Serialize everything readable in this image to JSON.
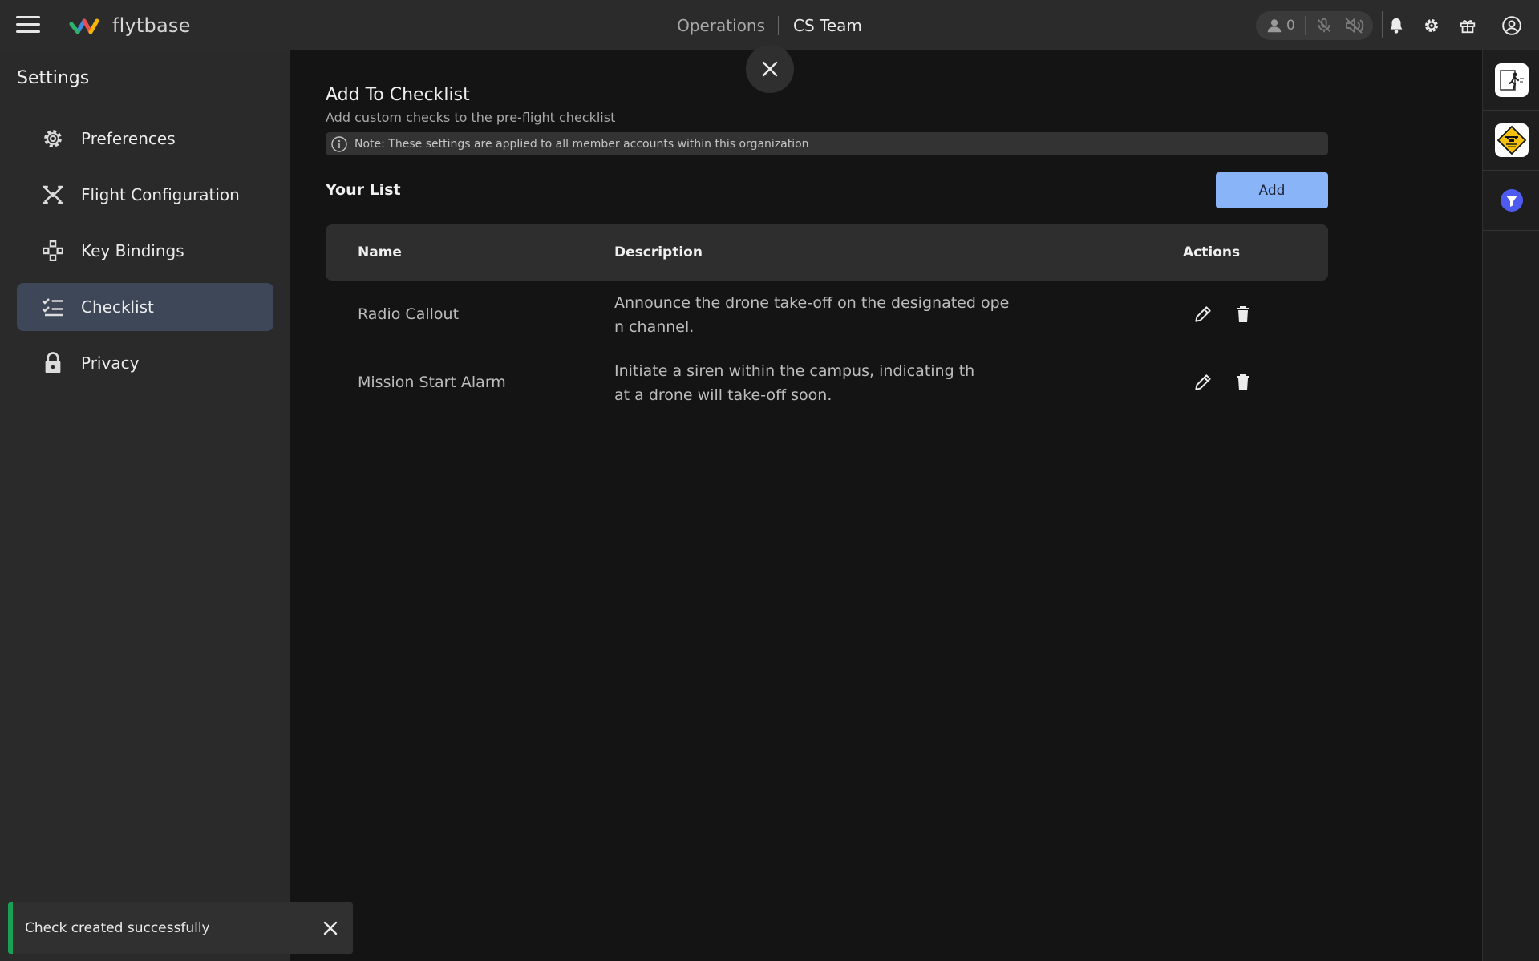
{
  "app": {
    "brand": "flytbase",
    "nav": {
      "operations": "Operations",
      "team": "CS Team"
    },
    "participants_count": "0"
  },
  "icons": {
    "menu": "hamburger-icon",
    "user": "user-icon",
    "mic": "mic-off-icon",
    "speaker": "speaker-off-icon",
    "bell": "bell-icon",
    "gear": "gear-icon",
    "gift": "gift-icon",
    "account": "account-icon",
    "close": "close-icon",
    "info": "info-icon",
    "edit": "pencil-icon",
    "delete": "trash-icon"
  },
  "sidebar": {
    "title": "Settings",
    "items": [
      {
        "label": "Preferences",
        "icon": "gear-icon",
        "active": false
      },
      {
        "label": "Flight Configuration",
        "icon": "drone-icon",
        "active": false
      },
      {
        "label": "Key Bindings",
        "icon": "gamepad-icon",
        "active": false
      },
      {
        "label": "Checklist",
        "icon": "checklist-icon",
        "active": true
      },
      {
        "label": "Privacy",
        "icon": "lock-icon",
        "active": false
      }
    ]
  },
  "main": {
    "title": "Add To Checklist",
    "subtitle": "Add custom checks to the pre-flight checklist",
    "note": "Note: These settings are applied to all member accounts within this organization",
    "list_title": "Your List",
    "add_label": "Add",
    "table": {
      "columns": [
        "Name",
        "Description",
        "Actions"
      ],
      "rows": [
        {
          "name": "Radio Callout",
          "description": "Announce the drone take-off on the designated open channel."
        },
        {
          "name": "Mission Start Alarm",
          "description": "Initiate a siren within the campus, indicating that a drone will take-off soon."
        }
      ]
    }
  },
  "toast": {
    "message": "Check created successfully"
  },
  "colors": {
    "accent": "#8ab4f8",
    "active_item": "#3d4758",
    "success": "#1aa052",
    "topbar": "#2b2b2b",
    "sidebar": "#2a2a2a",
    "background": "#141414"
  }
}
